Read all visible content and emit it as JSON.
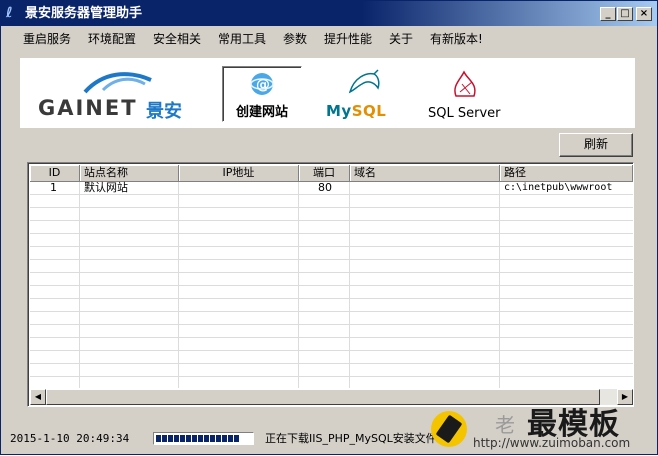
{
  "window": {
    "title": "景安服务器管理助手",
    "minimize_glyph": "_",
    "maximize_glyph": "□",
    "close_glyph": "×"
  },
  "menu": [
    "重启服务",
    "环境配置",
    "安全相关",
    "常用工具",
    "参数",
    "提升性能",
    "关于",
    "有新版本!"
  ],
  "toolbar": {
    "logo_brand": "GAINET",
    "logo_brand_cn": "景安",
    "create_site_label": "创建网站",
    "mysql_label_my": "My",
    "mysql_label_sql": "SQL",
    "sqlserver_label": "SQL Server"
  },
  "refresh_label": "刷新",
  "table": {
    "columns": [
      "ID",
      "站点名称",
      "IP地址",
      "端口",
      "域名",
      "路径"
    ],
    "rows": [
      {
        "id": "1",
        "name": "默认网站",
        "ip": "",
        "port": "80",
        "domain": "",
        "path": "c:\\inetpub\\wwwroot"
      }
    ]
  },
  "status": {
    "datetime": "2015-1-10 20:49:34",
    "progress": 0.85,
    "message": "正在下载IIS_PHP_MySQL安装文件"
  },
  "watermark": {
    "small": "老",
    "big": "最模板",
    "url": "http://www.zuimoban.com"
  },
  "colors": {
    "titlebar": "#0a246a",
    "face": "#d4d0c8",
    "progress_fill": "#0a246a",
    "mysql_blue": "#00758f",
    "mysql_orange": "#e48e00",
    "gainet_blue": "#1e78c8"
  }
}
